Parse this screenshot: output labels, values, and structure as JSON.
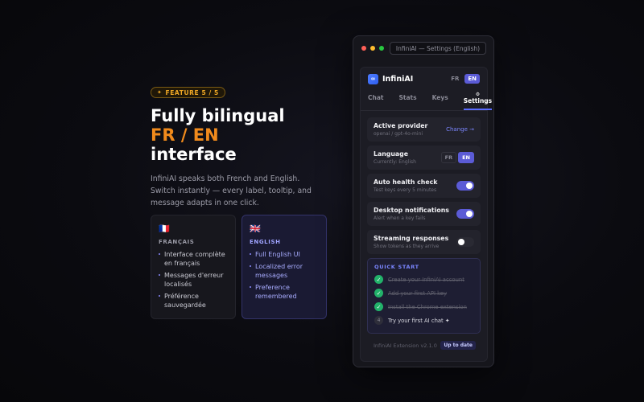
{
  "hero": {
    "badge_star": "✦",
    "badge_label": "FEATURE 5 / 5",
    "headline_line1": "Fully bilingual",
    "headline_accent": "FR / EN",
    "headline_line3": "interface",
    "lede": "InfiniAI speaks both French and English. Switch instantly — every label, tooltip, and message adapts in one click."
  },
  "cards": [
    {
      "flag": "🇫🇷",
      "title": "FRANÇAIS",
      "items": [
        "Interface complète en français",
        "Messages d'erreur localisés",
        "Préférence sauvegardée"
      ]
    },
    {
      "flag": "🇬🇧",
      "title": "ENGLISH",
      "items": [
        "Full English UI",
        "Localized error messages",
        "Preference remembered"
      ]
    }
  ],
  "window": {
    "address": "InfiniAI — Settings (English)",
    "brand": "InfiniAI",
    "logo_glyph": "∞",
    "lang": {
      "fr": "FR",
      "en": "EN",
      "active": "EN"
    },
    "tabs": [
      {
        "label": "Chat"
      },
      {
        "label": "Stats"
      },
      {
        "label": "Keys"
      },
      {
        "label": "Settings",
        "icon": "gear-icon",
        "glyph": "⚙",
        "active": true
      }
    ],
    "settings": {
      "provider": {
        "title": "Active provider",
        "sub": "openai / gpt-4o-mini",
        "action": "Change →"
      },
      "language": {
        "title": "Language",
        "sub": "Currently: English",
        "fr": "FR",
        "en": "EN"
      },
      "health": {
        "title": "Auto health check",
        "sub": "Test keys every 5 minutes",
        "enabled": true
      },
      "notifications": {
        "title": "Desktop notifications",
        "sub": "Alert when a key fails",
        "enabled": true
      },
      "streaming": {
        "title": "Streaming responses",
        "sub": "Show tokens as they arrive",
        "enabled": false
      }
    },
    "quick_start": {
      "title": "QUICK START",
      "steps": [
        {
          "text": "Create your InfiniAI account",
          "done": true,
          "mark": "✓"
        },
        {
          "text": "Add your first API key",
          "done": true,
          "mark": "✓"
        },
        {
          "text": "Install the Chrome extension",
          "done": true,
          "mark": "✓"
        },
        {
          "text": "Try your first AI chat ✦",
          "done": false,
          "mark": "4"
        }
      ]
    },
    "footer": {
      "version": "InfiniAI Extension v2.1.0",
      "status": "Up to date"
    }
  },
  "colors": {
    "accent_orange": "#f08a1c",
    "accent_indigo": "#5b5bd6",
    "success_green": "#22b26a"
  }
}
